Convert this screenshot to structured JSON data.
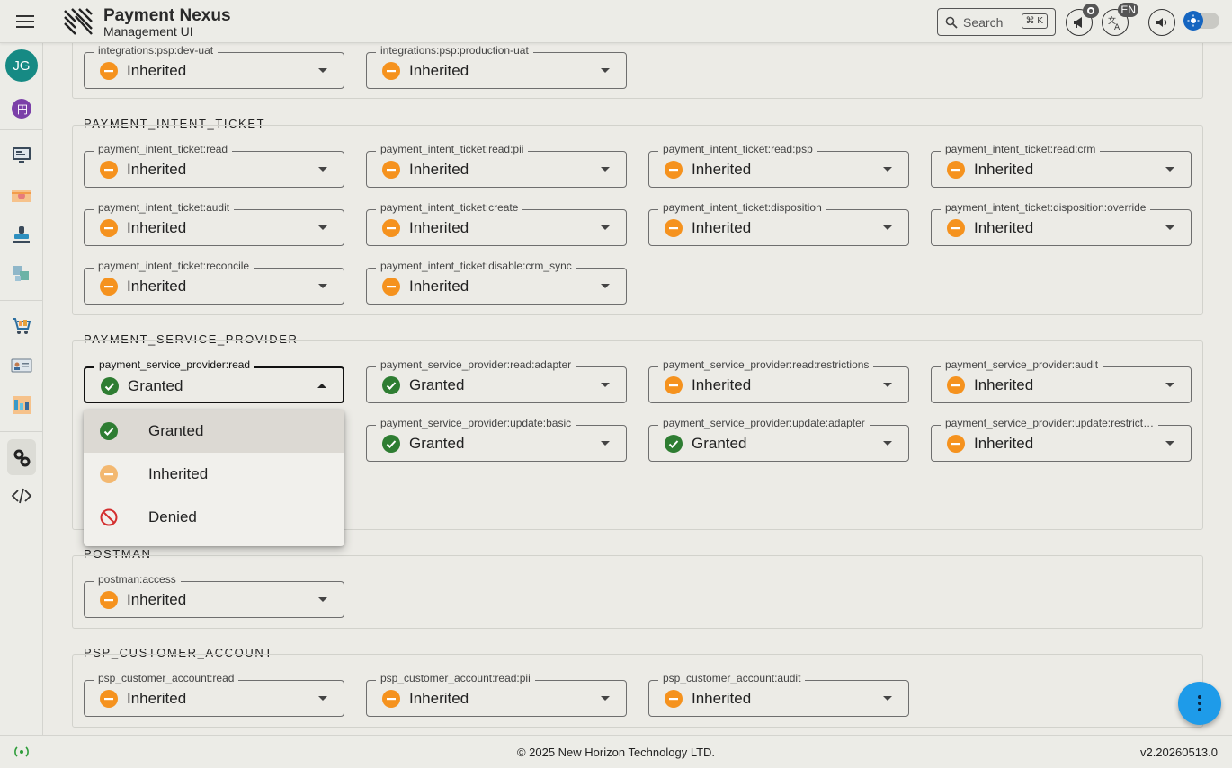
{
  "app": {
    "title": "Payment Nexus",
    "subtitle": "Management UI"
  },
  "header": {
    "search_label": "Search",
    "search_shortcut": "⌘ K",
    "announcements_badge": "",
    "language_badge": "EN"
  },
  "sidebar": {
    "avatar_initials": "JG"
  },
  "colors": {
    "granted": "#2e7d32",
    "inherited": "#f5921e",
    "denied": "#d32f2f",
    "accent": "#1e9be9"
  },
  "sections": [
    {
      "title": "",
      "fields": [
        {
          "label": "integrations:psp:dev-uat",
          "value": "Inherited",
          "status": "inherited"
        },
        {
          "label": "integrations:psp:production-uat",
          "value": "Inherited",
          "status": "inherited"
        }
      ]
    },
    {
      "title": "PAYMENT_INTENT_TICKET",
      "fields": [
        {
          "label": "payment_intent_ticket:read",
          "value": "Inherited",
          "status": "inherited"
        },
        {
          "label": "payment_intent_ticket:read:pii",
          "value": "Inherited",
          "status": "inherited"
        },
        {
          "label": "payment_intent_ticket:read:psp",
          "value": "Inherited",
          "status": "inherited"
        },
        {
          "label": "payment_intent_ticket:read:crm",
          "value": "Inherited",
          "status": "inherited"
        },
        {
          "label": "payment_intent_ticket:audit",
          "value": "Inherited",
          "status": "inherited"
        },
        {
          "label": "payment_intent_ticket:create",
          "value": "Inherited",
          "status": "inherited"
        },
        {
          "label": "payment_intent_ticket:disposition",
          "value": "Inherited",
          "status": "inherited"
        },
        {
          "label": "payment_intent_ticket:disposition:override",
          "value": "Inherited",
          "status": "inherited"
        },
        {
          "label": "payment_intent_ticket:reconcile",
          "value": "Inherited",
          "status": "inherited"
        },
        {
          "label": "payment_intent_ticket:disable:crm_sync",
          "value": "Inherited",
          "status": "inherited"
        }
      ]
    },
    {
      "title": "PAYMENT_SERVICE_PROVIDER",
      "fields": [
        {
          "label": "payment_service_provider:read",
          "value": "Granted",
          "status": "granted"
        },
        {
          "label": "payment_service_provider:read:adapter",
          "value": "Granted",
          "status": "granted"
        },
        {
          "label": "payment_service_provider:read:restrictions",
          "value": "Inherited",
          "status": "inherited"
        },
        {
          "label": "payment_service_provider:audit",
          "value": "Inherited",
          "status": "inherited"
        },
        {
          "label": "",
          "value": "",
          "status": "hidden"
        },
        {
          "label": "payment_service_provider:update:basic",
          "value": "Granted",
          "status": "granted"
        },
        {
          "label": "payment_service_provider:update:adapter",
          "value": "Granted",
          "status": "granted"
        },
        {
          "label": "payment_service_provider:update:restrict…",
          "value": "Inherited",
          "status": "inherited"
        }
      ]
    },
    {
      "title": "POSTMAN",
      "fields": [
        {
          "label": "postman:access",
          "value": "Inherited",
          "status": "inherited"
        }
      ]
    },
    {
      "title": "PSP_CUSTOMER_ACCOUNT",
      "fields": [
        {
          "label": "psp_customer_account:read",
          "value": "Inherited",
          "status": "inherited"
        },
        {
          "label": "psp_customer_account:read:pii",
          "value": "Inherited",
          "status": "inherited"
        },
        {
          "label": "psp_customer_account:audit",
          "value": "Inherited",
          "status": "inherited"
        }
      ]
    }
  ],
  "dropdown": {
    "options": [
      {
        "label": "Granted",
        "status": "granted",
        "selected": true
      },
      {
        "label": "Inherited",
        "status": "inherited",
        "selected": false
      },
      {
        "label": "Denied",
        "status": "denied",
        "selected": false
      }
    ]
  },
  "footer": {
    "copyright": "© 2025 New Horizon Technology LTD.",
    "version": "v2.20260513.0"
  }
}
